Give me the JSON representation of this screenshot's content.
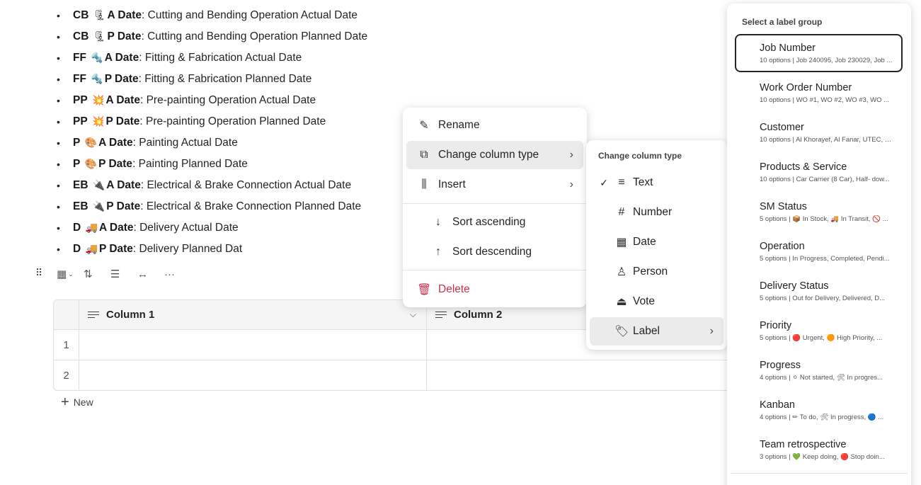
{
  "bullets": [
    {
      "abbr": "CB",
      "emoji": "🗜",
      "suffix": "A Date",
      "desc": ": Cutting and Bending Operation Actual Date"
    },
    {
      "abbr": "CB",
      "emoji": "🗜",
      "suffix": "P Date",
      "desc": ": Cutting and Bending Operation Planned Date"
    },
    {
      "abbr": "FF",
      "emoji": "🔩",
      "suffix": "A Date",
      "desc": ": Fitting & Fabrication Actual Date"
    },
    {
      "abbr": "FF",
      "emoji": "🔩",
      "suffix": "P Date",
      "desc": ": Fitting & Fabrication Planned Date"
    },
    {
      "abbr": "PP",
      "emoji": "💥",
      "suffix": "A Date",
      "desc": ": Pre-painting Operation Actual Date"
    },
    {
      "abbr": "PP",
      "emoji": "💥",
      "suffix": "P Date",
      "desc": ": Pre-painting Operation Planned Date"
    },
    {
      "abbr": "P",
      "emoji": "🎨",
      "suffix": "A Date",
      "desc": ": Painting Actual Date"
    },
    {
      "abbr": "P",
      "emoji": "🎨",
      "suffix": "P Date",
      "desc": ": Painting Planned Date"
    },
    {
      "abbr": "EB",
      "emoji": "🔌",
      "suffix": "A Date",
      "desc": ": Electrical & Brake Connection Actual Date"
    },
    {
      "abbr": "EB",
      "emoji": "🔌",
      "suffix": "P Date",
      "desc": ": Electrical & Brake Connection Planned Date"
    },
    {
      "abbr": "D",
      "emoji": "🚚",
      "suffix": "A Date",
      "desc": ": Delivery Actual Date"
    },
    {
      "abbr": "D",
      "emoji": "🚚",
      "suffix": "P Date",
      "desc": ": Delivery Planned Dat"
    }
  ],
  "table": {
    "columns": [
      "Column 1",
      "Column 2"
    ],
    "rows": [
      "1",
      "2"
    ],
    "new_label": "New"
  },
  "context_menu": {
    "rename": "Rename",
    "change_type": "Change column type",
    "insert": "Insert",
    "sort_asc": "Sort ascending",
    "sort_desc": "Sort descending",
    "delete": "Delete"
  },
  "submenu": {
    "title": "Change column type",
    "items": [
      "Text",
      "Number",
      "Date",
      "Person",
      "Vote",
      "Label"
    ],
    "checked": "Text",
    "active": "Label"
  },
  "label_panel": {
    "title": "Select a label group",
    "groups": [
      {
        "name": "Job Number",
        "desc": "10 options | Job 240095, Job 230029, Job ..."
      },
      {
        "name": "Work Order Number",
        "desc": "10 options | WO #1, WO #2, WO #3, WO ..."
      },
      {
        "name": "Customer",
        "desc": "10 options | Al Khorayef, Al Fanar, UTEC, S..."
      },
      {
        "name": "Products & Service",
        "desc": "10 options | Car Carrier (8 Car), Half- dow..."
      },
      {
        "name": "SM Status",
        "desc": "5 options | 📦 In Stock, 🚚 In Transit, 🚫 ..."
      },
      {
        "name": "Operation",
        "desc": "5 options | In Progress, Completed, Pendi..."
      },
      {
        "name": "Delivery Status",
        "desc": "5 options | Out for Delivery, Delivered, D..."
      },
      {
        "name": "Priority",
        "desc": "5 options | 🔴 Urgent, 🟠 High Priority, ..."
      },
      {
        "name": "Progress",
        "desc": "4 options | ⚪ Not started, 🛠 In progres..."
      },
      {
        "name": "Kanban",
        "desc": "4 options | ✏ To do, 🛠 In progress, 🔵 ..."
      },
      {
        "name": "Team retrospective",
        "desc": "3 options | 💚 Keep doing, 🔴 Stop doin..."
      }
    ],
    "selected": "Job Number"
  }
}
